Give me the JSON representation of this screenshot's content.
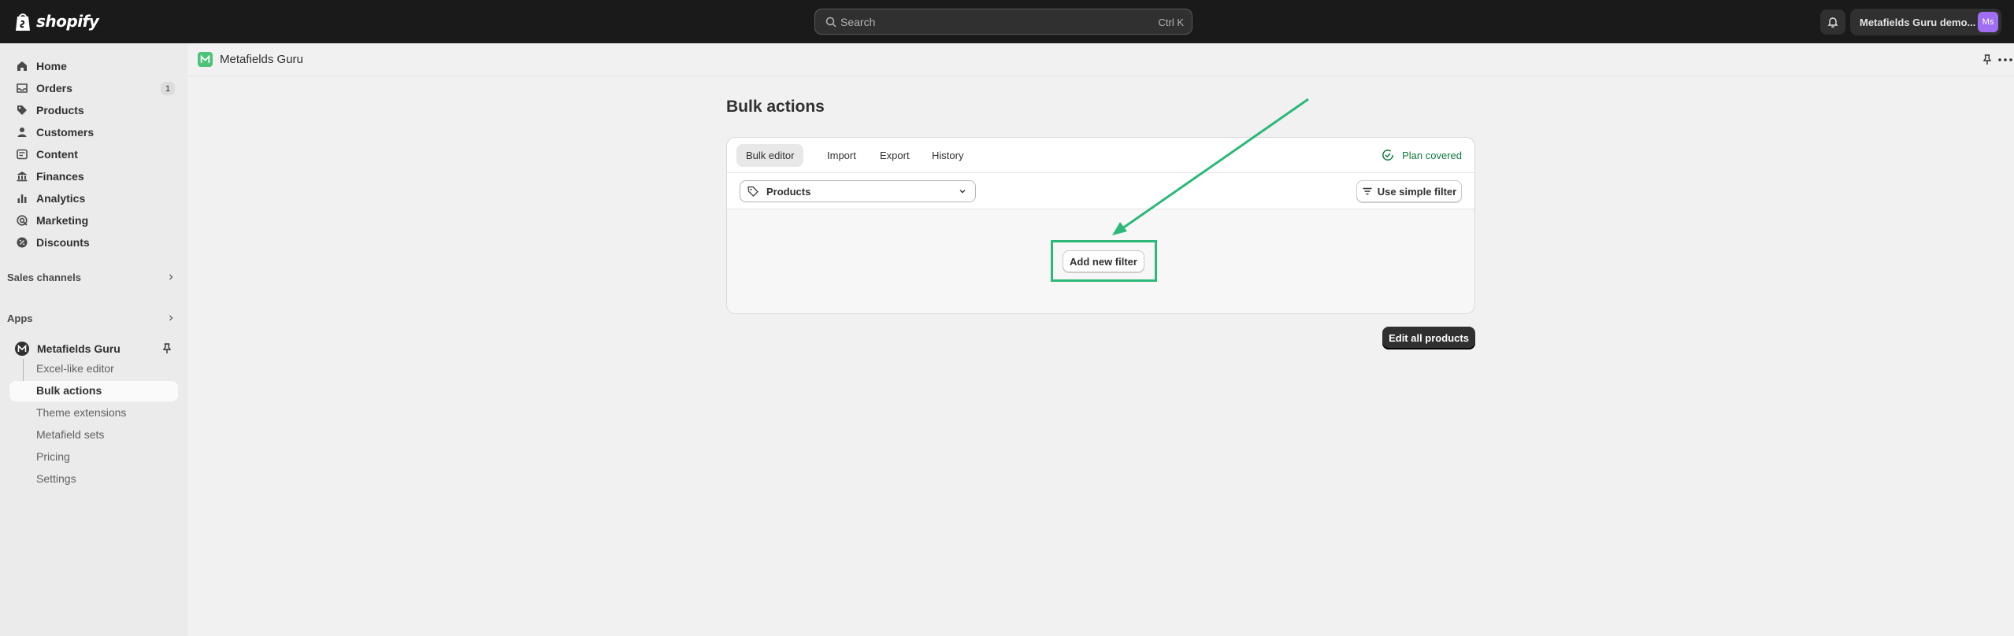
{
  "topbar": {
    "brand": "shopify",
    "search_placeholder": "Search",
    "search_shortcut": "Ctrl K",
    "store_name": "Metafields Guru demo...",
    "avatar_initials": "Ms"
  },
  "sidebar": {
    "items": [
      {
        "label": "Home",
        "icon": "home-icon"
      },
      {
        "label": "Orders",
        "icon": "orders-icon",
        "badge": "1"
      },
      {
        "label": "Products",
        "icon": "tag-icon"
      },
      {
        "label": "Customers",
        "icon": "person-icon"
      },
      {
        "label": "Content",
        "icon": "content-icon"
      },
      {
        "label": "Finances",
        "icon": "bank-icon"
      },
      {
        "label": "Analytics",
        "icon": "bar-chart-icon"
      },
      {
        "label": "Marketing",
        "icon": "target-icon"
      },
      {
        "label": "Discounts",
        "icon": "discount-icon"
      }
    ],
    "sales_channels": "Sales channels",
    "apps": "Apps",
    "app_name": "Metafields Guru",
    "app_subitems": [
      "Excel-like editor",
      "Bulk actions",
      "Theme extensions",
      "Metafield sets",
      "Pricing",
      "Settings"
    ],
    "active_subitem": "Bulk actions"
  },
  "header": {
    "app_title": "Metafields Guru"
  },
  "page": {
    "title": "Bulk actions",
    "tabs": [
      "Bulk editor",
      "Import",
      "Export",
      "History"
    ],
    "active_tab": "Bulk editor",
    "plan_status": "Plan covered",
    "resource_select": "Products",
    "simple_filter_button": "Use simple filter",
    "add_filter_button": "Add new filter",
    "edit_all_button": "Edit all products"
  },
  "colors": {
    "accent_green": "#2cb878",
    "plan_green": "#0f7a3d",
    "topbar": "#1a1a1a"
  }
}
